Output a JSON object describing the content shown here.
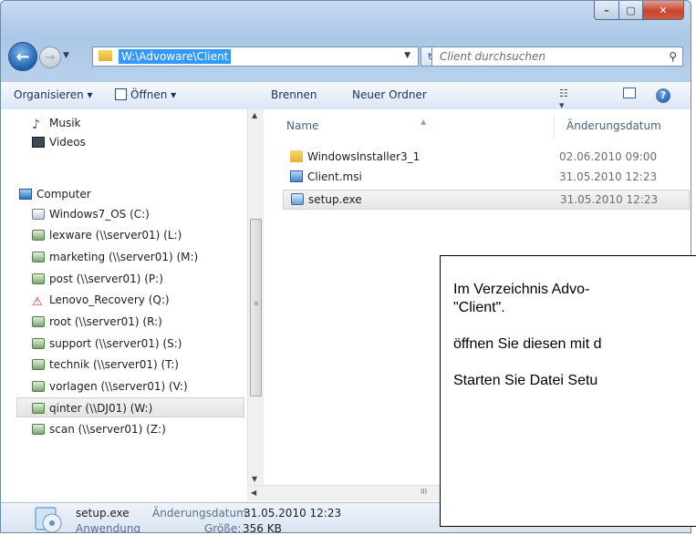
{
  "window": {
    "minimize_glyph": "–",
    "maximize_glyph": "▢",
    "close_glyph": "✕"
  },
  "navigation": {
    "back_glyph": "←",
    "forward_glyph": "→",
    "address": "W:\\Advoware\\Client",
    "refresh_glyph": "↻",
    "search_placeholder": "Client durchsuchen",
    "search_glyph": "⚲"
  },
  "toolbar": {
    "organize": "Organisieren ▾",
    "open": "Öffnen ▾",
    "burn": "Brennen",
    "new_folder": "Neuer Ordner",
    "help_glyph": "?"
  },
  "nav_pane": {
    "items": [
      {
        "label": "Musik",
        "icon": "music-icon"
      },
      {
        "label": "Videos",
        "icon": "videos-icon"
      },
      {
        "label": "Computer",
        "icon": "computer-icon"
      },
      {
        "label": "Windows7_OS (C:)",
        "icon": "local-drive-icon"
      },
      {
        "label": "lexware (\\\\server01) (L:)",
        "icon": "network-drive-icon"
      },
      {
        "label": "marketing (\\\\server01) (M:)",
        "icon": "network-drive-icon"
      },
      {
        "label": "post (\\\\server01) (P:)",
        "icon": "network-drive-icon"
      },
      {
        "label": "Lenovo_Recovery (Q:)",
        "icon": "recovery-drive-icon"
      },
      {
        "label": "root (\\\\server01) (R:)",
        "icon": "network-drive-icon"
      },
      {
        "label": "support (\\\\server01) (S:)",
        "icon": "network-drive-icon"
      },
      {
        "label": "technik (\\\\server01) (T:)",
        "icon": "network-drive-icon"
      },
      {
        "label": "vorlagen (\\\\server01) (V:)",
        "icon": "network-drive-icon"
      },
      {
        "label": "qinter (\\\\DJ01) (W:)",
        "icon": "network-drive-icon",
        "selected": true
      },
      {
        "label": "scan (\\\\server01) (Z:)",
        "icon": "network-drive-icon"
      }
    ]
  },
  "file_list": {
    "columns": [
      "Name",
      "Änderungsdatum"
    ],
    "rows": [
      {
        "name": "WindowsInstaller3_1",
        "date": "02.06.2010 09:00",
        "icon": "folder-icon"
      },
      {
        "name": "Client.msi",
        "date": "31.05.2010 12:23",
        "icon": "msi-icon"
      },
      {
        "name": "setup.exe",
        "date": "31.05.2010 12:23",
        "icon": "exe-icon",
        "selected": true
      }
    ]
  },
  "scrollbar": {
    "grip": "≡",
    "hgrip": "III"
  },
  "details": {
    "filename": "setup.exe",
    "date_label": "Änderungsdatum:",
    "date_value": "31.05.2010 12:23",
    "type": "Anwendung",
    "size_label": "Größe:",
    "size_value": "356 KB"
  },
  "callout": {
    "line1": "Im Verzeichnis Advo-",
    "line2": "\"Client\".",
    "line3": "öffnen Sie diesen mit d",
    "line4": "Starten Sie Datei Setu"
  }
}
